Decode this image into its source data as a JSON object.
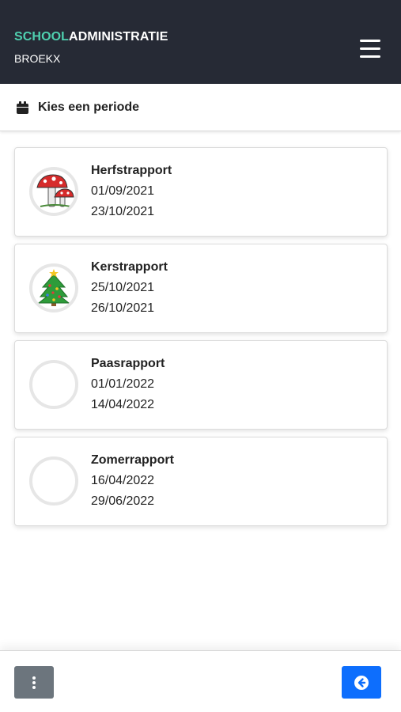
{
  "header": {
    "brand_part1": "SCHOOL",
    "brand_part2": "ADMINISTRATIE",
    "school_name": "BROEKX",
    "menu_icon": "hamburger-menu-icon"
  },
  "period_section": {
    "icon": "calendar-icon",
    "title": "Kies een periode"
  },
  "periods": [
    {
      "title": "Herfstrapport",
      "start": "01/09/2021",
      "end": "23/10/2021",
      "image": "mushroom-image"
    },
    {
      "title": "Kerstrapport",
      "start": "25/10/2021",
      "end": "26/10/2021",
      "image": "christmas-tree-image"
    },
    {
      "title": "Paasrapport",
      "start": "01/01/2022",
      "end": "14/04/2022",
      "image": "empty-image"
    },
    {
      "title": "Zomerrapport",
      "start": "16/04/2022",
      "end": "29/06/2022",
      "image": "empty-image"
    }
  ],
  "footer": {
    "more_icon": "vertical-ellipsis-icon",
    "back_icon": "circle-arrow-left-icon"
  },
  "colors": {
    "topbar": "#262a35",
    "brand_accent": "#4fd1b0",
    "more_button": "#6c757d",
    "back_button": "#0d6efd"
  }
}
